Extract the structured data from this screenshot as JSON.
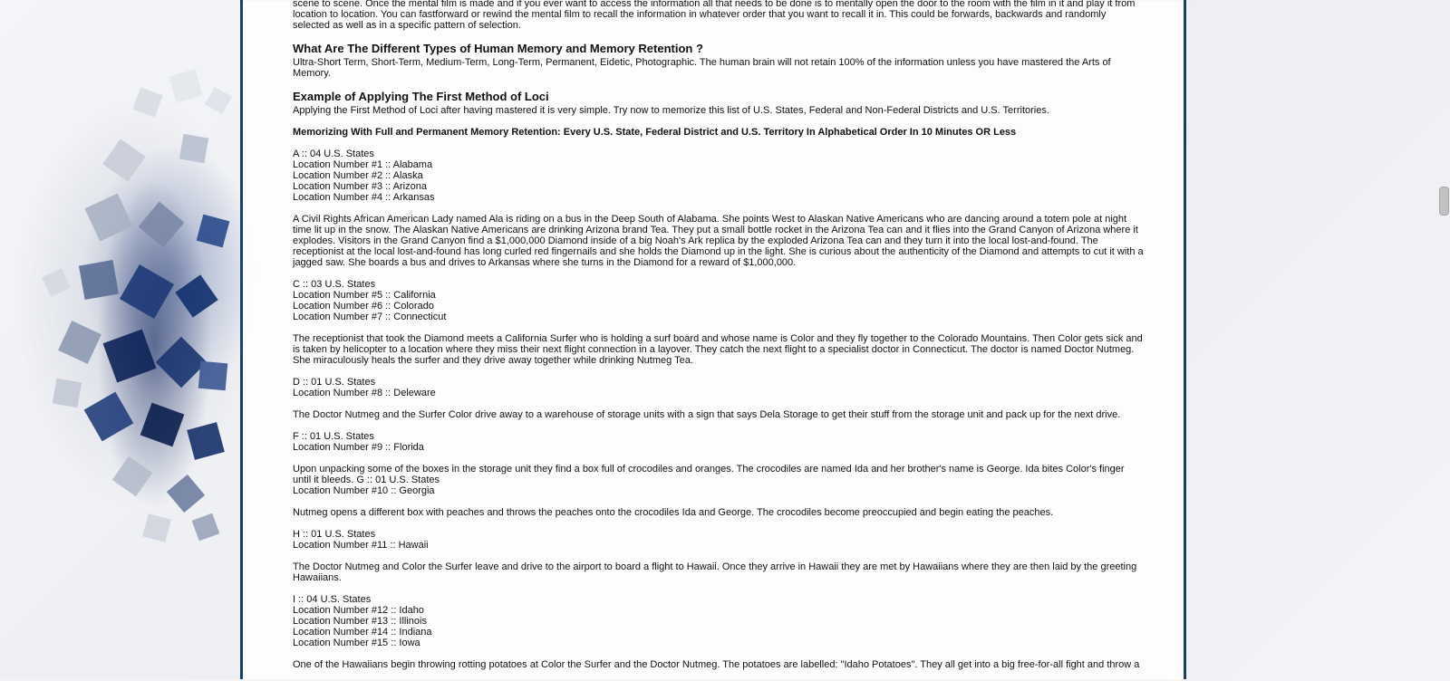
{
  "article": {
    "intro_tail": "photographic memory. By recalling the movie that you created in your head and placed in the corner locations in each room you will recall all of the details of that mentally created film from scene to scene. Once the mental film is made and if you ever want to access the information all that needs to be done is to mentally open the door to the room with the film in it and play it from location to location. You can fastforward or rewind the mental film to recall the information in whatever order that you want to recall it in. This could be forwards, backwards and randomly selected as well as in a specific pattern of selection.",
    "h_types": "What Are The Different Types of Human Memory and Memory Retention ?",
    "types_text": "Ultra-Short Term, Short-Term, Medium-Term, Long-Term, Permanent, Eidetic, Photographic. The human brain will not retain 100% of the information unless you have mastered the Arts of Memory.",
    "h_example": "Example of Applying The First Method of Loci",
    "example_text": "Applying the First Method of Loci after having mastered it is very simple. Try now to memorize this list of U.S. States, Federal and Non-Federal Districts and U.S. Territories.",
    "bold_title": "Memorizing With Full and Permanent Memory Retention: Every U.S. State, Federal District and U.S. Territory In Alphabetical Order In 10 Minutes OR Less",
    "group_a": [
      "A :: 04 U.S. States",
      "Location Number #1 :: Alabama",
      "Location Number #2 :: Alaska",
      "Location Number #3 :: Arizona",
      "Location Number #4 :: Arkansas"
    ],
    "story_a": "A Civil Rights African American Lady named Ala is riding on a bus in the Deep South of Alabama. She points West to Alaskan Native Americans who are dancing around a totem pole at night time lit up in the snow. The Alaskan Native Americans are drinking Arizona brand Tea. They put a small bottle rocket in the Arizona Tea can and it flies into the Grand Canyon of Arizona where it explodes. Visitors in the Grand Canyon find a $1,000,000 Diamond inside of a big Noah's Ark replica by the exploded Arizona Tea can and they turn it into the local lost-and-found. The receptionist at the local lost-and-found has long curled red fingernails and she holds the Diamond up in the light. She is curious about the authenticity of the Diamond and attempts to cut it with a jagged saw. She boards a bus and drives to Arkansas where she turns in the Diamond for a reward of $1,000,000.",
    "group_c": [
      "C :: 03 U.S. States",
      "Location Number #5 :: California",
      "Location Number #6 :: Colorado",
      "Location Number #7 :: Connecticut"
    ],
    "story_c": "The receptionist that took the Diamond meets a California Surfer who is holding a surf board and whose name is Color and they fly together to the Colorado Mountains. Then Color gets sick and is taken by helicopter to a location where they miss their next flight connection in a layover. They catch the next flight to a specialist doctor in Connecticut. The doctor is named Doctor Nutmeg. She miraculously heals the surfer and they drive away together while drinking Nutmeg Tea.",
    "group_d": [
      "D :: 01 U.S. States",
      "Location Number #8 :: Deleware"
    ],
    "story_d": "The Doctor Nutmeg and the Surfer Color drive away to a warehouse of storage units with a sign that says Dela Storage to get their stuff from the storage unit and pack up for the next drive.",
    "group_f": [
      "F :: 01 U.S. States",
      "Location Number #9 :: Florida"
    ],
    "story_f": "Upon unpacking some of the boxes in the storage unit they find a box full of crocodiles and oranges. The crocodiles are named Ida and her brother's name is George. Ida bites Color's finger until it bleeds. G :: 01 U.S. States",
    "group_g_loc": "Location Number #10 :: Georgia",
    "story_g": "Nutmeg opens a different box with peaches and throws the peaches onto the crocodiles Ida and George. The crocodiles become preoccupied and begin eating the peaches.",
    "group_h": [
      "H :: 01 U.S. States",
      "Location Number #11 :: Hawaii"
    ],
    "story_h": "The Doctor Nutmeg and Color the Surfer leave and drive to the airport to board a flight to Hawaii. Once they arrive in Hawaii they are met by Hawaiians where they are then laid by the greeting Hawaiians.",
    "group_i": [
      "I :: 04 U.S. States",
      "Location Number #12 :: Idaho",
      "Location Number #13 :: Illinois",
      "Location Number #14 :: Indiana",
      "Location Number #15 :: Iowa"
    ],
    "story_i": "One of the Hawaiians begin throwing rotting potatoes at Color the Surfer and the Doctor Nutmeg. The potatoes are labelled: \"Idaho Potatoes\". They all get into a big free-for-all fight and throw a"
  },
  "colors": {
    "border": "#1d3f6b",
    "text": "#111111",
    "scroll_thumb": "#c2c2c2"
  }
}
